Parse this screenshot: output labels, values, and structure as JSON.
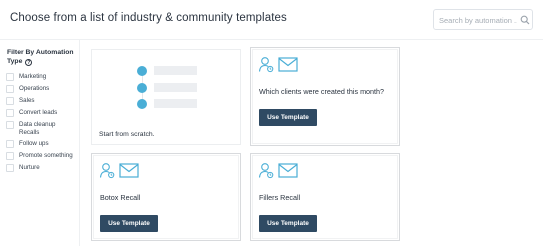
{
  "header": {
    "title": "Choose from a list of industry & community templates",
    "search_placeholder": "Search by automation ..."
  },
  "sidebar": {
    "heading": "Filter By Automation Type",
    "info_icon": "?",
    "filters": [
      {
        "label": "Marketing",
        "checked": false
      },
      {
        "label": "Operations",
        "checked": false
      },
      {
        "label": "Sales",
        "checked": false
      },
      {
        "label": "Convert leads",
        "checked": false
      },
      {
        "label": "Data cleanup Recalls",
        "checked": false
      },
      {
        "label": "Follow ups",
        "checked": false
      },
      {
        "label": "Promote something",
        "checked": false
      },
      {
        "label": "Nurture",
        "checked": false
      }
    ]
  },
  "cards": {
    "scratch": {
      "label": "Start from scratch."
    },
    "clients": {
      "title": "Which clients were created this month?",
      "button": "Use Template"
    },
    "botox": {
      "title": "Botox Recall",
      "button": "Use Template"
    },
    "fillers": {
      "title": "Fillers Recall",
      "button": "Use Template"
    }
  },
  "colors": {
    "accent_icon": "#4aaed6",
    "button_bg": "#2f4a63",
    "text": "#2b3440"
  }
}
